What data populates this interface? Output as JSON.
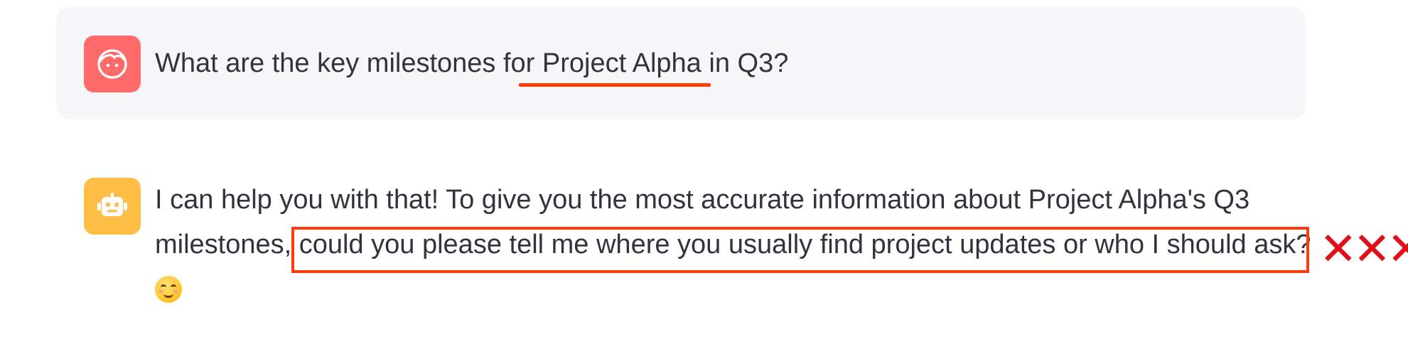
{
  "conversation": {
    "user_message": {
      "text": "What are the key milestones for Project Alpha in Q3?",
      "avatar_icon": "user-face-icon",
      "avatar_color": "#ff6b6b"
    },
    "assistant_message": {
      "line1": "I can help you with that! To give you the most accurate information about Project Alpha's Q3",
      "line2_start": "milestones, ",
      "line2_highlighted": "could you please tell me where you usually find project updates or who I should ask?",
      "emoji": "smiling-face-icon",
      "avatar_icon": "robot-icon",
      "avatar_color": "#ffbe45"
    }
  },
  "annotations": {
    "underline_color": "#ff3b0a",
    "box_color": "#ff3b0a",
    "x_marks": "✕✕✕",
    "x_marks_color": "#e0101a"
  }
}
